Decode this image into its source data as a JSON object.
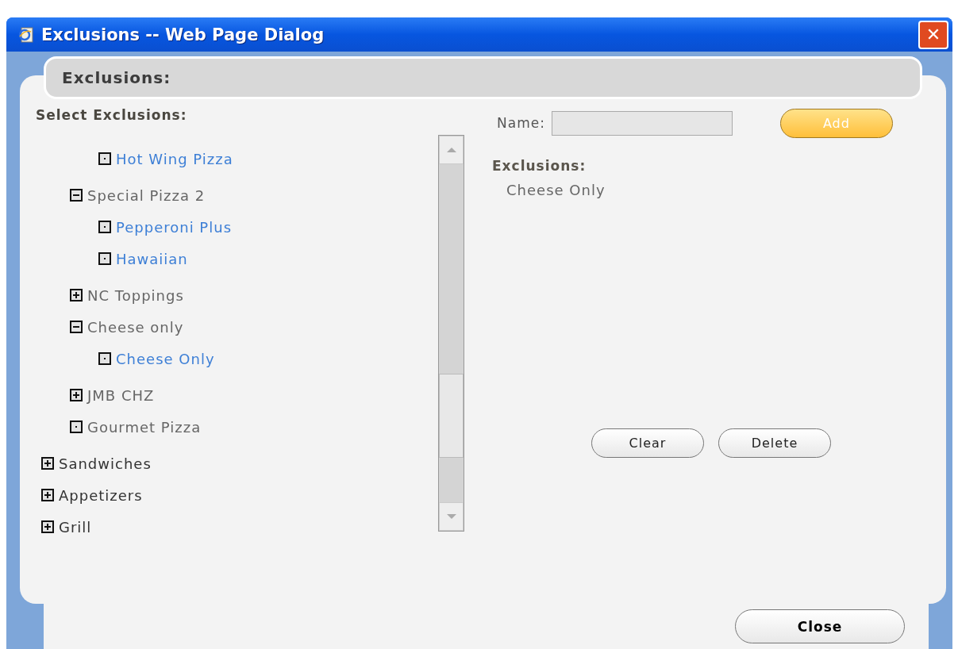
{
  "window": {
    "title": "Exclusions -- Web Page Dialog",
    "close_glyph": "✕"
  },
  "header": {
    "title": "Exclusions:"
  },
  "tree": {
    "title": "Select Exclusions:",
    "items": [
      {
        "kind": "hidden",
        "children": [
          {
            "kind": "hidden",
            "children": [
              {
                "kind": "exclusion",
                "label": "Hot Wing Pizza"
              }
            ]
          },
          {
            "kind": "category",
            "label": "Special Pizza 2",
            "expanded": true,
            "children": [
              {
                "kind": "exclusion",
                "label": "Pepperoni Plus"
              },
              {
                "kind": "exclusion",
                "label": "Hawaiian"
              }
            ]
          },
          {
            "kind": "category",
            "label": "NC Toppings",
            "expanded": false
          },
          {
            "kind": "category",
            "label": "Cheese only",
            "expanded": true,
            "children": [
              {
                "kind": "exclusion",
                "label": "Cheese Only"
              }
            ]
          },
          {
            "kind": "category",
            "label": "JMB CHZ",
            "expanded": false
          },
          {
            "kind": "category",
            "label": "Gourmet Pizza"
          }
        ]
      },
      {
        "kind": "category",
        "label": "Sandwiches",
        "expanded": false
      },
      {
        "kind": "category",
        "label": "Appetizers",
        "expanded": false
      },
      {
        "kind": "category",
        "label": "Grill",
        "expanded": false
      }
    ]
  },
  "name_field": {
    "label": "Name:"
  },
  "add_button": {
    "label": "Add",
    "disabled": true
  },
  "exclusions": {
    "title": "Exclusions:",
    "items": [
      "Cheese Only"
    ]
  },
  "buttons": [
    "Clear",
    "Delete"
  ],
  "close_button": "Close"
}
